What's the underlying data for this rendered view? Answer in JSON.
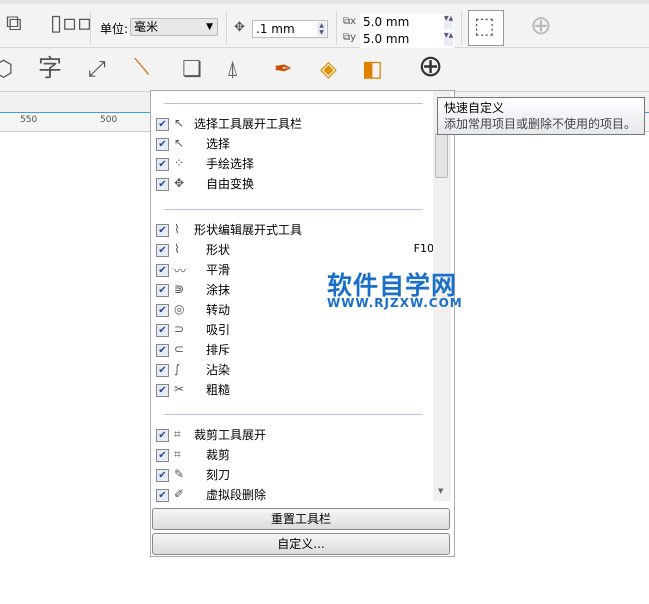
{
  "toolbar1": {
    "unit_label": "单位:",
    "unit_value": "毫米",
    "nudge_value": ".1 mm",
    "dup_x": "5.0 mm",
    "dup_y": "5.0 mm"
  },
  "ruler": {
    "ticks": [
      "550",
      "500"
    ]
  },
  "panel": {
    "groups": [
      {
        "items": [
          {
            "label": "选择工具展开工具栏",
            "icon": "↖",
            "header": true
          },
          {
            "label": "选择",
            "icon": "↖"
          },
          {
            "label": "手绘选择",
            "icon": "⁘"
          },
          {
            "label": "自由变换",
            "icon": "✥"
          }
        ]
      },
      {
        "items": [
          {
            "label": "形状编辑展开式工具",
            "icon": "⌇",
            "header": true
          },
          {
            "label": "形状",
            "icon": "⌇",
            "shortcut": "F10"
          },
          {
            "label": "平滑",
            "icon": "〰"
          },
          {
            "label": "涂抹",
            "icon": "⋑"
          },
          {
            "label": "转动",
            "icon": "◎"
          },
          {
            "label": "吸引",
            "icon": "⊃"
          },
          {
            "label": "排斥",
            "icon": "⊂"
          },
          {
            "label": "沾染",
            "icon": "∫"
          },
          {
            "label": "粗糙",
            "icon": "✂"
          }
        ]
      },
      {
        "items": [
          {
            "label": "裁剪工具展开",
            "icon": "⌗",
            "header": true
          },
          {
            "label": "裁剪",
            "icon": "⌗"
          },
          {
            "label": "刻刀",
            "icon": "✎"
          },
          {
            "label": "虚拟段删除",
            "icon": "✐"
          }
        ]
      }
    ],
    "reset_label": "重置工具栏",
    "customize_label": "自定义..."
  },
  "tooltip": {
    "title": "快速自定义",
    "text": "添加常用项目或删除不使用的项目。"
  },
  "watermark": {
    "title": "软件自学网",
    "url": "WWW.RJZXW.COM"
  }
}
